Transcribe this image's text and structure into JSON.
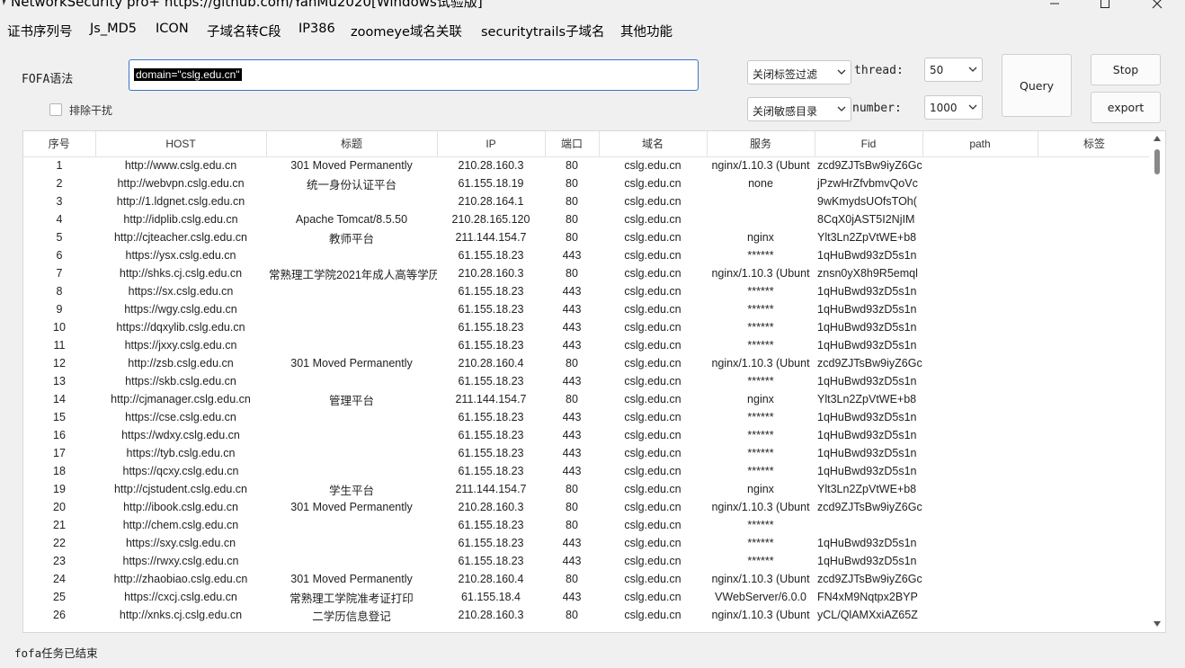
{
  "window": {
    "title": "NetworkSecurity pro+ https://github.com/YanMu2020[Windows试验版]"
  },
  "menu": [
    "证书序列号",
    "Js_MD5",
    "ICON",
    "子域名转C段",
    "IP386",
    "zoomeye域名关联",
    "securitytrails子域名",
    "其他功能"
  ],
  "search": {
    "label": "FOFA语法",
    "query": "domain=\"cslg.edu.cn\"",
    "exclude_label": "排除干扰"
  },
  "filters": {
    "tag_filter": "关闭标签过滤",
    "sensitive_dir": "关闭敏感目录",
    "thread_label": "thread:",
    "thread_value": "50",
    "number_label": "number:",
    "number_value": "1000"
  },
  "buttons": {
    "query": "Query",
    "stop": "Stop",
    "export": "export"
  },
  "table": {
    "columns": [
      "序号",
      "HOST",
      "标题",
      "IP",
      "端口",
      "域名",
      "服务",
      "Fid",
      "path",
      "标签"
    ],
    "rows": [
      [
        "1",
        "http://www.cslg.edu.cn",
        "301 Moved Permanently",
        "210.28.160.3",
        "80",
        "cslg.edu.cn",
        "nginx/1.10.3 (Ubunt",
        "zcd9ZJTsBw9iyZ6Gc",
        "",
        ""
      ],
      [
        "2",
        "http://webvpn.cslg.edu.cn",
        "统一身份认证平台",
        "61.155.18.19",
        "80",
        "cslg.edu.cn",
        "none",
        "jPzwHrZfvbmvQoVc",
        "",
        ""
      ],
      [
        "3",
        "http://1.ldgnet.cslg.edu.cn",
        "",
        "210.28.164.1",
        "80",
        "cslg.edu.cn",
        "",
        "9wKmydsUOfsTOh(",
        "",
        ""
      ],
      [
        "4",
        "http://idplib.cslg.edu.cn",
        "Apache Tomcat/8.5.50",
        "210.28.165.120",
        "80",
        "cslg.edu.cn",
        "",
        "8CqX0jAST5I2NjIM",
        "",
        ""
      ],
      [
        "5",
        "http://cjteacher.cslg.edu.cn",
        "教师平台",
        "211.144.154.7",
        "80",
        "cslg.edu.cn",
        "nginx",
        "Ylt3Ln2ZpVtWE+b8",
        "",
        ""
      ],
      [
        "6",
        "https://ysx.cslg.edu.cn",
        "",
        "61.155.18.23",
        "443",
        "cslg.edu.cn",
        "******",
        "1qHuBwd93zD5s1n",
        "",
        ""
      ],
      [
        "7",
        "http://shks.cj.cslg.edu.cn",
        "常熟理工学院2021年成人高等学历",
        "210.28.160.3",
        "80",
        "cslg.edu.cn",
        "nginx/1.10.3 (Ubunt",
        "znsn0yX8h9R5emql",
        "",
        ""
      ],
      [
        "8",
        "https://sx.cslg.edu.cn",
        "",
        "61.155.18.23",
        "443",
        "cslg.edu.cn",
        "******",
        "1qHuBwd93zD5s1n",
        "",
        ""
      ],
      [
        "9",
        "https://wgy.cslg.edu.cn",
        "",
        "61.155.18.23",
        "443",
        "cslg.edu.cn",
        "******",
        "1qHuBwd93zD5s1n",
        "",
        ""
      ],
      [
        "10",
        "https://dqxylib.cslg.edu.cn",
        "",
        "61.155.18.23",
        "443",
        "cslg.edu.cn",
        "******",
        "1qHuBwd93zD5s1n",
        "",
        ""
      ],
      [
        "11",
        "https://jxxy.cslg.edu.cn",
        "",
        "61.155.18.23",
        "443",
        "cslg.edu.cn",
        "******",
        "1qHuBwd93zD5s1n",
        "",
        ""
      ],
      [
        "12",
        "http://zsb.cslg.edu.cn",
        "301 Moved Permanently",
        "210.28.160.4",
        "80",
        "cslg.edu.cn",
        "nginx/1.10.3 (Ubunt",
        "zcd9ZJTsBw9iyZ6Gc",
        "",
        ""
      ],
      [
        "13",
        "https://skb.cslg.edu.cn",
        "",
        "61.155.18.23",
        "443",
        "cslg.edu.cn",
        "******",
        "1qHuBwd93zD5s1n",
        "",
        ""
      ],
      [
        "14",
        "http://cjmanager.cslg.edu.cn",
        "管理平台",
        "211.144.154.7",
        "80",
        "cslg.edu.cn",
        "nginx",
        "Ylt3Ln2ZpVtWE+b8",
        "",
        ""
      ],
      [
        "15",
        "https://cse.cslg.edu.cn",
        "",
        "61.155.18.23",
        "443",
        "cslg.edu.cn",
        "******",
        "1qHuBwd93zD5s1n",
        "",
        ""
      ],
      [
        "16",
        "https://wdxy.cslg.edu.cn",
        "",
        "61.155.18.23",
        "443",
        "cslg.edu.cn",
        "******",
        "1qHuBwd93zD5s1n",
        "",
        ""
      ],
      [
        "17",
        "https://tyb.cslg.edu.cn",
        "",
        "61.155.18.23",
        "443",
        "cslg.edu.cn",
        "******",
        "1qHuBwd93zD5s1n",
        "",
        ""
      ],
      [
        "18",
        "https://qcxy.cslg.edu.cn",
        "",
        "61.155.18.23",
        "443",
        "cslg.edu.cn",
        "******",
        "1qHuBwd93zD5s1n",
        "",
        ""
      ],
      [
        "19",
        "http://cjstudent.cslg.edu.cn",
        "学生平台",
        "211.144.154.7",
        "80",
        "cslg.edu.cn",
        "nginx",
        "Ylt3Ln2ZpVtWE+b8",
        "",
        ""
      ],
      [
        "20",
        "http://ibook.cslg.edu.cn",
        "301 Moved Permanently",
        "210.28.160.3",
        "80",
        "cslg.edu.cn",
        "nginx/1.10.3 (Ubunt",
        "zcd9ZJTsBw9iyZ6Gc",
        "",
        ""
      ],
      [
        "21",
        "http://chem.cslg.edu.cn",
        "",
        "61.155.18.23",
        "80",
        "cslg.edu.cn",
        "******",
        "",
        "",
        ""
      ],
      [
        "22",
        "https://sxy.cslg.edu.cn",
        "",
        "61.155.18.23",
        "443",
        "cslg.edu.cn",
        "******",
        "1qHuBwd93zD5s1n",
        "",
        ""
      ],
      [
        "23",
        "https://rwxy.cslg.edu.cn",
        "",
        "61.155.18.23",
        "443",
        "cslg.edu.cn",
        "******",
        "1qHuBwd93zD5s1n",
        "",
        ""
      ],
      [
        "24",
        "http://zhaobiao.cslg.edu.cn",
        "301 Moved Permanently",
        "210.28.160.4",
        "80",
        "cslg.edu.cn",
        "nginx/1.10.3 (Ubunt",
        "zcd9ZJTsBw9iyZ6Gc",
        "",
        ""
      ],
      [
        "25",
        "https://cxcj.cslg.edu.cn",
        "常熟理工学院准考证打印",
        "61.155.18.4",
        "443",
        "cslg.edu.cn",
        "VWebServer/6.0.0",
        "FN4xM9Nqtpx2BYP",
        "",
        ""
      ],
      [
        "26",
        "http://xnks.cj.cslg.edu.cn",
        "二学历信息登记",
        "210.28.160.3",
        "80",
        "cslg.edu.cn",
        "nginx/1.10.3 (Ubunt",
        "yCL/QlAMXxiAZ65Z",
        "",
        ""
      ]
    ]
  },
  "status": "fofa任务已结束"
}
